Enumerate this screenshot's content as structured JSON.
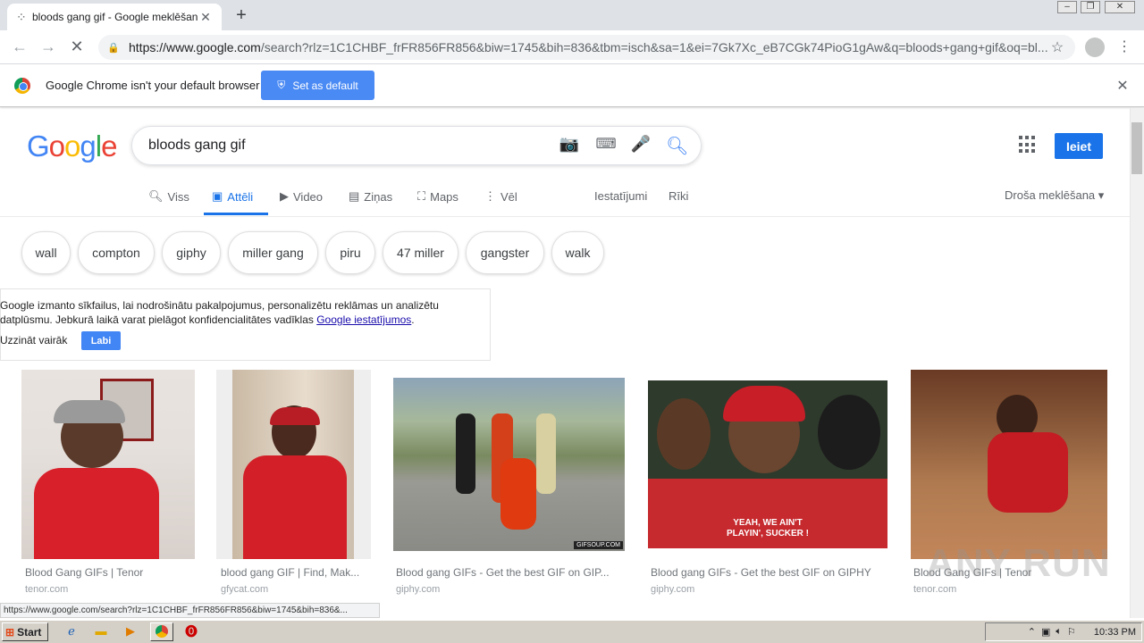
{
  "browser": {
    "tab_title": "bloods gang gif - Google meklēšana",
    "tab_close": "✕",
    "new_tab": "+",
    "url_host": "https://www.google.com",
    "url_rest": "/search?rlz=1C1CHBF_frFR856FR856&biw=1745&bih=836&tbm=isch&sa=1&ei=7Gk7Xc_eB7CGk74PioG1gAw&q=bloods+gang+gif&oq=bl...",
    "status_url": "https://www.google.com/search?rlz=1C1CHBF_frFR856FR856&biw=1745&bih=836&..."
  },
  "infobar": {
    "message": "Google Chrome isn't your default browser",
    "button": "Set as default"
  },
  "google": {
    "logo": [
      "G",
      "o",
      "o",
      "g",
      "l",
      "e"
    ],
    "logo_colors": [
      "#4285f4",
      "#ea4335",
      "#fbbc05",
      "#4285f4",
      "#34a853",
      "#ea4335"
    ],
    "query": "bloods gang gif",
    "signin": "Ieiet",
    "tabs": [
      {
        "label": "Viss",
        "icon": "search-icon"
      },
      {
        "label": "Attēli",
        "icon": "image-icon"
      },
      {
        "label": "Video",
        "icon": "video-icon"
      },
      {
        "label": "Ziņas",
        "icon": "news-icon"
      },
      {
        "label": "Maps",
        "icon": "map-icon"
      },
      {
        "label": "Vēl",
        "icon": "more-icon"
      }
    ],
    "settings": "Iestatījumi",
    "tools": "Rīki",
    "safesearch": "Droša meklēšana"
  },
  "chips": [
    "wall",
    "compton",
    "giphy",
    "miller gang",
    "piru",
    "47 miller",
    "gangster",
    "walk"
  ],
  "cookie": {
    "text": "Google izmanto sīkfailus, lai nodrošinātu pakalpojumus, personalizētu reklāmas un analizētu datplūsmu. Jebkurā laikā varat pielāgot konfidencialitātes vadīklas",
    "link": "Google iestatījumos",
    "learn_more": "Uzzināt vairāk",
    "ok": "Labi"
  },
  "results": [
    {
      "title": "Blood Gang GIFs | Tenor",
      "site": "tenor.com"
    },
    {
      "title": "blood gang GIF | Find, Mak...",
      "site": "gfycat.com"
    },
    {
      "title": "Blood gang GIFs - Get the best GIF on GIP...",
      "site": "giphy.com"
    },
    {
      "title": "Blood gang GIFs - Get the best GIF on GIPHY",
      "site": "giphy.com"
    },
    {
      "title": "Blood Gang GIFs | Tenor",
      "site": "tenor.com"
    }
  ],
  "overlay_texts": {
    "gifsoup": "GIFSOUP.COM",
    "caption1": "YEAH, WE AIN'T",
    "caption2": "PLAYIN', SUCKER !"
  },
  "taskbar": {
    "start": "Start",
    "clock": "10:33 PM"
  },
  "watermark": "ANY RUN"
}
